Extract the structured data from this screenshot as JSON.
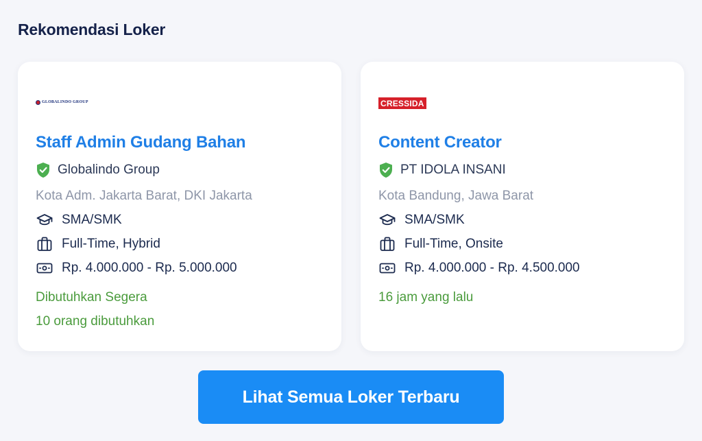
{
  "section": {
    "title": "Rekomendasi Loker"
  },
  "jobs": [
    {
      "logo_text": "GLOBALINDO GROUP",
      "title": "Staff Admin Gudang Bahan",
      "company": "Globalindo Group",
      "location": "Kota Adm. Jakarta Barat, DKI Jakarta",
      "education": "SMA/SMK",
      "work_type": "Full-Time, Hybrid",
      "salary": "Rp. 4.000.000 - Rp. 5.000.000",
      "status": "Dibutuhkan Segera",
      "openings": "10 orang dibutuhkan"
    },
    {
      "logo_text": "CRESSIDA",
      "title": "Content Creator",
      "company": "PT IDOLA INSANI",
      "location": "Kota Bandung, Jawa Barat",
      "education": "SMA/SMK",
      "work_type": "Full-Time, Onsite",
      "salary": "Rp. 4.000.000 - Rp. 4.500.000",
      "status": "16 jam yang lalu"
    }
  ],
  "cta": {
    "label": "Lihat Semua Loker Terbaru"
  },
  "icons": {
    "verified": "verified-shield-icon",
    "education": "graduation-cap-icon",
    "work_type": "briefcase-icon",
    "salary": "banknote-icon"
  },
  "colors": {
    "accent": "#1a8cf5",
    "job_title": "#1f7fe6",
    "verified": "#4caf50",
    "status": "#4a9b3c",
    "heading": "#15224a",
    "muted": "#8e96a8",
    "background": "#f5f6fa"
  }
}
